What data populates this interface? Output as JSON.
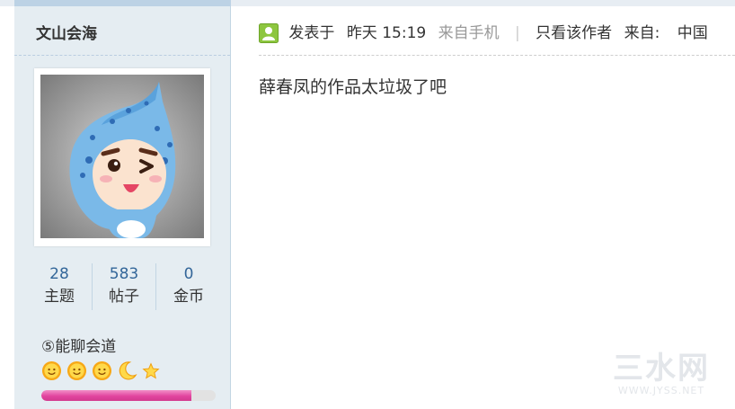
{
  "sidebar": {
    "username": "文山会海",
    "avatar_alt": "avatar",
    "stats": [
      {
        "value": "28",
        "label": "主题"
      },
      {
        "value": "583",
        "label": "帖子"
      },
      {
        "value": "0",
        "label": "金币"
      }
    ],
    "group_name": "⑤能聊会道",
    "level_icons": [
      "sun-icon",
      "sun-icon",
      "sun-icon",
      "moon-icon",
      "star-icon"
    ],
    "level_progress": 0.86
  },
  "post": {
    "posted_label": "发表于",
    "posted_time": "昨天 15:19",
    "source": "来自手机",
    "separator": "|",
    "only_author": "只看该作者",
    "from_label": "来自:",
    "from_value": "中国",
    "content": "薛春凤的作品太垃圾了吧"
  },
  "watermark": {
    "big": "三水网",
    "small": "WWW.JYSS.NET"
  },
  "colors": {
    "sidebar_bg": "#e5edf2",
    "stat_number": "#336699",
    "level_bar_fill": "#e2459f",
    "online_icon": "#8dc63f"
  }
}
